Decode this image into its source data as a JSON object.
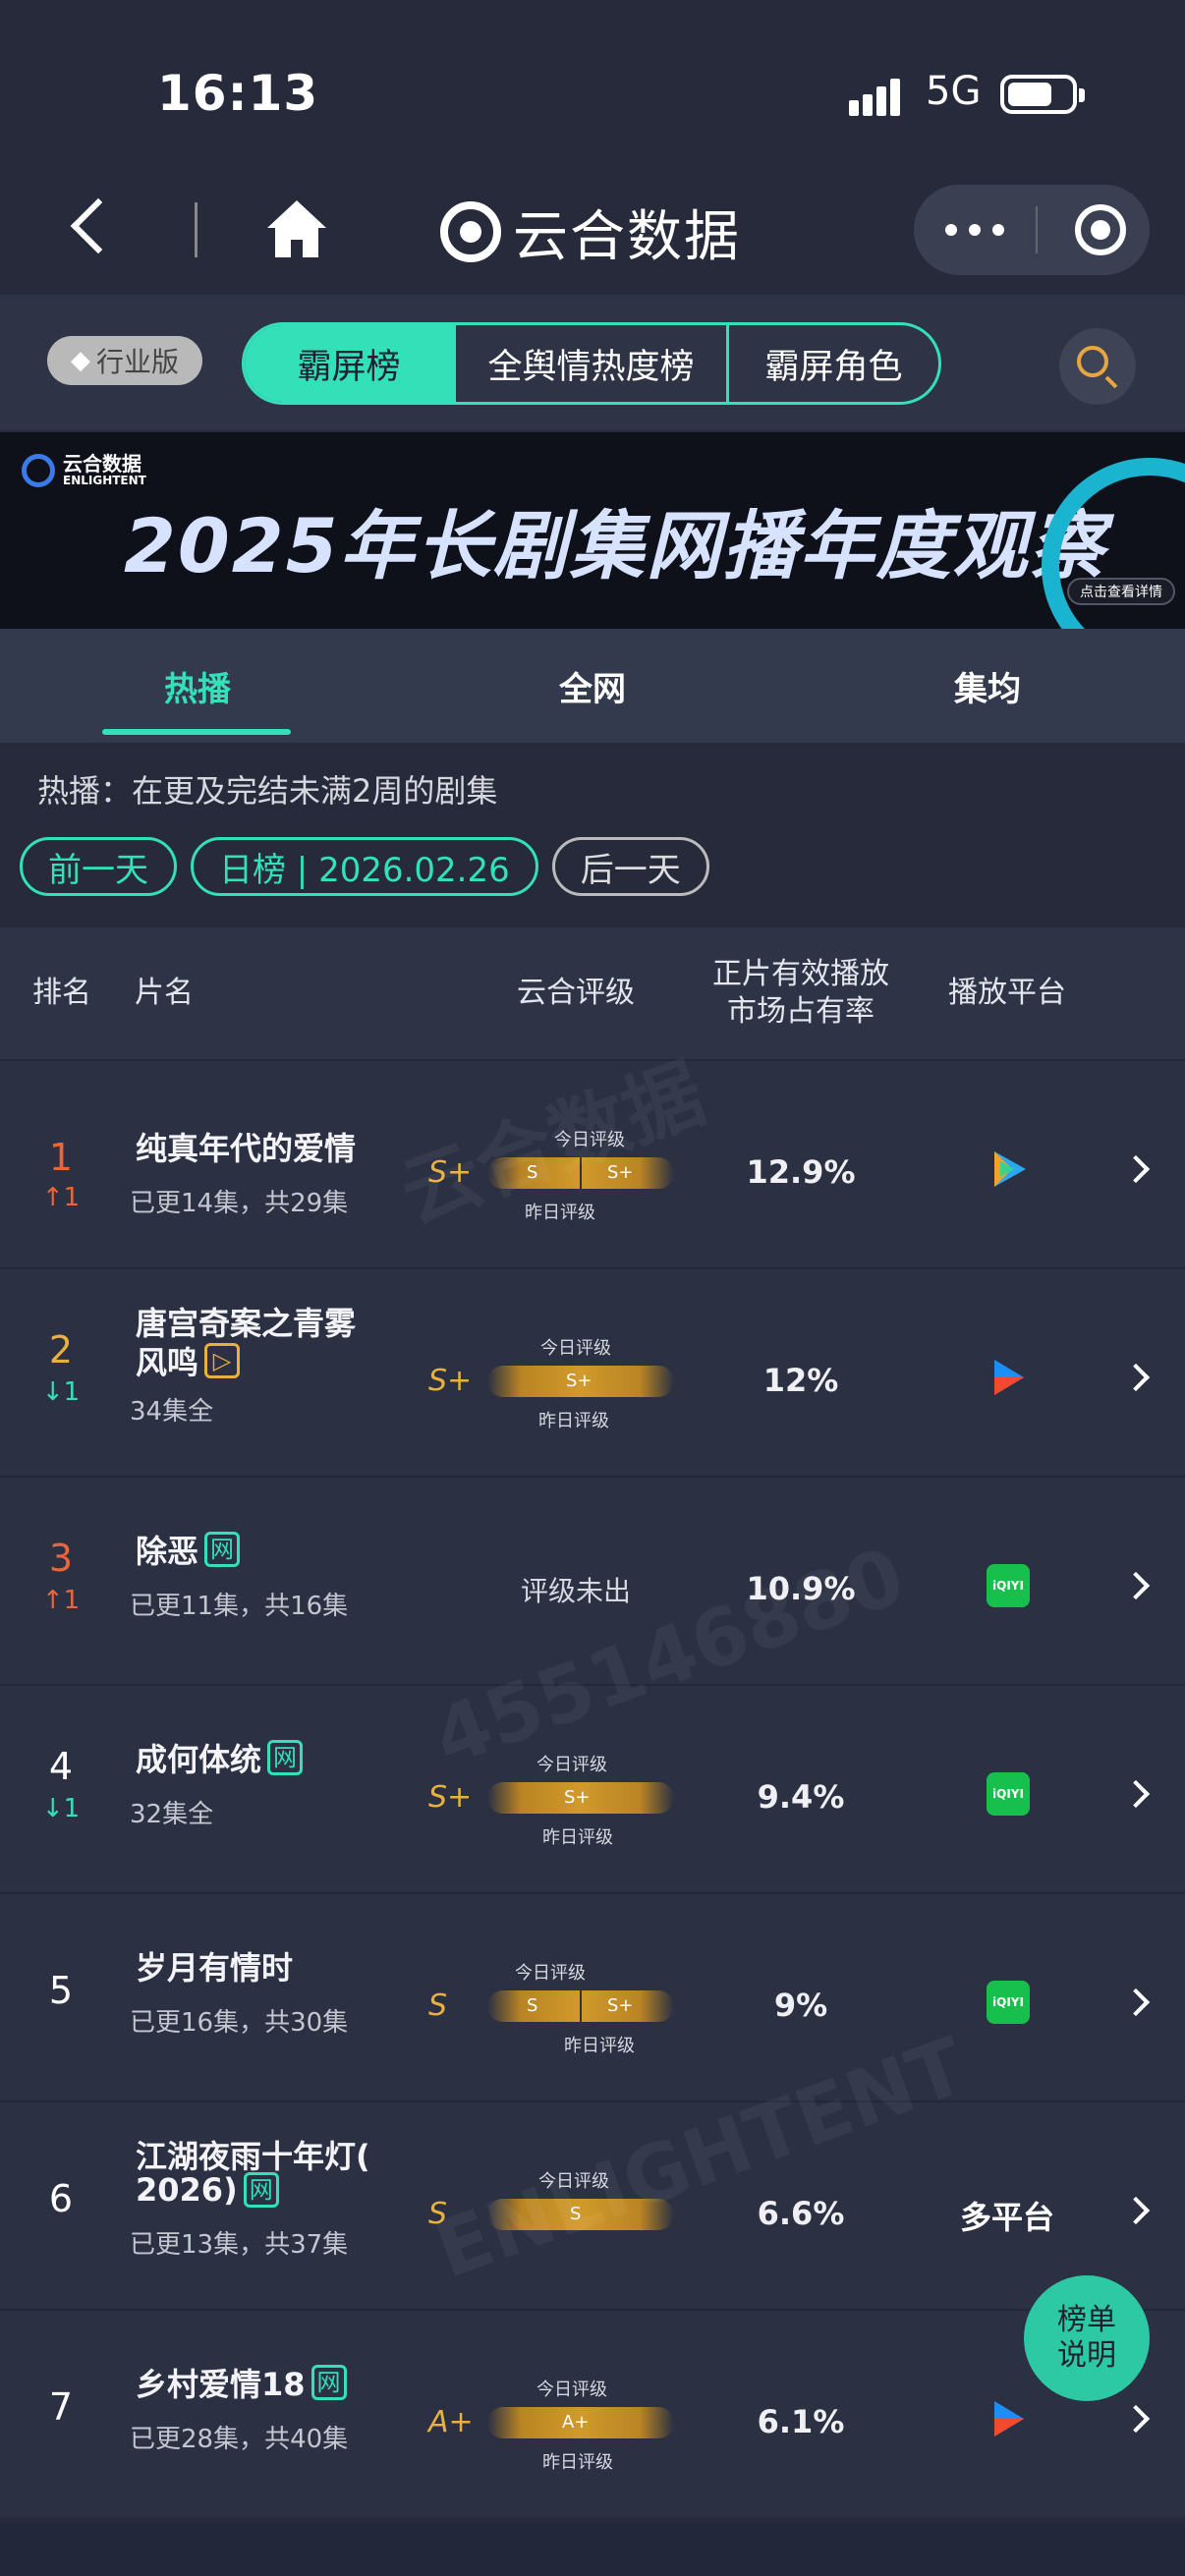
{
  "status_bar": {
    "time": "16:13",
    "network": "5G"
  },
  "nav": {
    "title": "云合数据"
  },
  "tools": {
    "edition_badge": "行业版",
    "segments": [
      {
        "label": "霸屏榜",
        "active": true
      },
      {
        "label": "全舆情热度榜",
        "active": false
      },
      {
        "label": "霸屏角色",
        "active": false
      }
    ]
  },
  "banner": {
    "logo_cn": "云合数据",
    "logo_en": "ENLIGHTENT",
    "title": "2025年长剧集网播年度观察",
    "cta": "点击查看详情"
  },
  "subtabs": [
    {
      "label": "热播",
      "active": true
    },
    {
      "label": "全网",
      "active": false
    },
    {
      "label": "集均",
      "active": false
    }
  ],
  "description": "热播：在更及完结未满2周的剧集",
  "date_nav": {
    "prev": "前一天",
    "current": "日榜 | 2026.02.26",
    "next": "后一天"
  },
  "table": {
    "headers": {
      "rank": "排名",
      "title": "片名",
      "grade": "云合评级",
      "share_line1": "正片有效播放",
      "share_line2": "市场占有率",
      "platform": "播放平台"
    },
    "grade_labels": {
      "today": "今日评级",
      "yesterday": "昨日评级"
    },
    "rows": [
      {
        "rank": "1",
        "change": "↑1",
        "title_l1": "纯真年代的爱情",
        "title_l2": "",
        "tag": "",
        "episodes": "已更14集，共29集",
        "grade": "S+",
        "bar_left": "S",
        "bar_right": "S+",
        "share": "12.9%",
        "platform": "tencent-video-icon"
      },
      {
        "rank": "2",
        "change": "↓1",
        "title_l1": "唐宫奇案之青雾",
        "title_l2": "风鸣",
        "tag": "▷",
        "episodes": "34集全",
        "grade": "S+",
        "bar_left": "",
        "bar_right": "S+",
        "share": "12%",
        "platform": "youku-icon"
      },
      {
        "rank": "3",
        "change": "↑1",
        "title_l1": "除恶",
        "title_l2": "",
        "tag": "网",
        "episodes": "已更11集，共16集",
        "grade": "",
        "no_grade": "评级未出",
        "share": "10.9%",
        "platform": "iqiyi-icon"
      },
      {
        "rank": "4",
        "change": "↓1",
        "title_l1": "成何体统",
        "title_l2": "",
        "tag": "网",
        "episodes": "32集全",
        "grade": "S+",
        "bar_left": "",
        "bar_right": "S+",
        "share": "9.4%",
        "platform": "iqiyi-icon"
      },
      {
        "rank": "5",
        "change": "",
        "title_l1": "岁月有情时",
        "title_l2": "",
        "tag": "",
        "episodes": "已更16集，共30集",
        "grade": "S",
        "bar_left": "S",
        "bar_right": "S+",
        "share": "9%",
        "platform": "iqiyi-icon"
      },
      {
        "rank": "6",
        "change": "",
        "title_l1": "江湖夜雨十年灯(",
        "title_l2": "2026)",
        "tag": "网",
        "episodes": "已更13集，共37集",
        "grade": "S",
        "bar_left": "",
        "bar_right": "S",
        "share": "6.6%",
        "platform_text": "多平台"
      },
      {
        "rank": "7",
        "change": "",
        "title_l1": "乡村爱情18",
        "title_l2": "",
        "tag": "网",
        "episodes": "已更28集，共40集",
        "grade": "A+",
        "bar_left": "",
        "bar_right": "A+",
        "share": "6.1%",
        "platform": "youku-icon"
      }
    ]
  },
  "fab": {
    "line1": "榜单",
    "line2": "说明"
  },
  "watermark": {
    "brand_cn": "云合数据",
    "brand_en": "ENLIGHTENT",
    "id": "455146880"
  },
  "platform_icons": {
    "iqiyi_text": "iQIYI"
  },
  "colors": {
    "accent": "#33e0b8",
    "gold": "#e8b040",
    "up": "#e8663a",
    "background": "#262a3a"
  }
}
